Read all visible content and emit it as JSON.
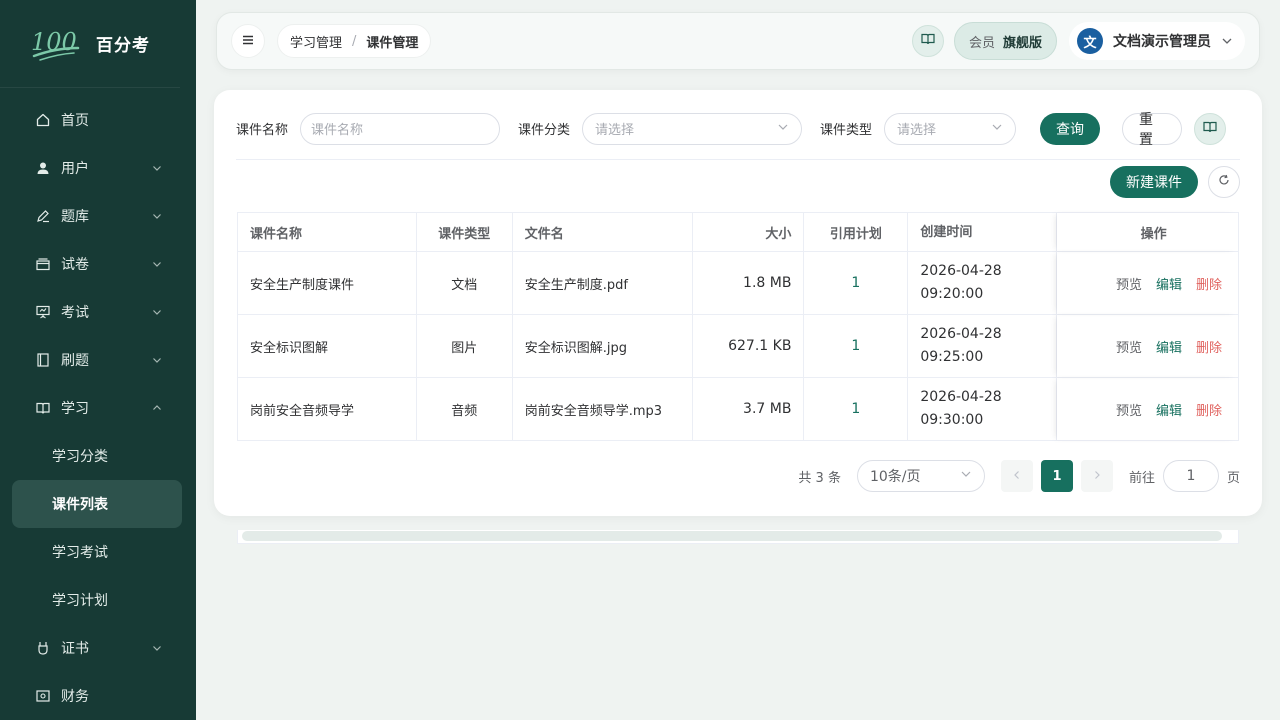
{
  "app": {
    "logo_mark": "100",
    "name": "百分考"
  },
  "sidebar": {
    "items": [
      {
        "label": "首页",
        "icon": "home-icon"
      },
      {
        "label": "用户",
        "icon": "user-icon"
      },
      {
        "label": "题库",
        "icon": "edit-icon"
      },
      {
        "label": "试卷",
        "icon": "paper-icon"
      },
      {
        "label": "考试",
        "icon": "presentation-icon"
      },
      {
        "label": "刷题",
        "icon": "notebook-icon"
      },
      {
        "label": "学习",
        "icon": "book-icon"
      },
      {
        "label": "证书",
        "icon": "medal-icon"
      },
      {
        "label": "财务",
        "icon": "finance-icon"
      }
    ],
    "study_sub": [
      {
        "label": "学习分类"
      },
      {
        "label": "课件列表"
      },
      {
        "label": "学习考试"
      },
      {
        "label": "学习计划"
      }
    ]
  },
  "header": {
    "breadcrumb": [
      "学习管理",
      "课件管理"
    ],
    "breadcrumb_sep": "/",
    "vip_label": "会员",
    "vip_value": "旗舰版",
    "avatar_char": "文",
    "user_name": "文档演示管理员"
  },
  "filters": {
    "name_label": "课件名称",
    "name_placeholder": "课件名称",
    "category_label": "课件分类",
    "category_placeholder": "请选择",
    "type_label": "课件类型",
    "type_placeholder": "请选择",
    "search_button": "查询",
    "reset_button": "重置"
  },
  "toolbar": {
    "new_button": "新建课件"
  },
  "table": {
    "headers": [
      "课件名称",
      "课件类型",
      "文件名",
      "大小",
      "引用计划",
      "创建时间",
      "操作"
    ],
    "rows": [
      {
        "name": "安全生产制度课件",
        "type": "文档",
        "file": "安全生产制度.pdf",
        "size": "1.8 MB",
        "refs": "1",
        "date": "2026-04-28",
        "time": "09:20:00"
      },
      {
        "name": "安全标识图解",
        "type": "图片",
        "file": "安全标识图解.jpg",
        "size": "627.1 KB",
        "refs": "1",
        "date": "2026-04-28",
        "time": "09:25:00"
      },
      {
        "name": "岗前安全音频导学",
        "type": "音频",
        "file": "岗前安全音频导学.mp3",
        "size": "3.7 MB",
        "refs": "1",
        "date": "2026-04-28",
        "time": "09:30:00"
      }
    ],
    "actions": {
      "preview": "预览",
      "edit": "编辑",
      "delete": "删除"
    }
  },
  "pagination": {
    "total": "共 3 条",
    "page_size": "10条/页",
    "current_page": "1",
    "goto_label": "前往",
    "goto_value": "1",
    "page_suffix": "页"
  },
  "colors": {
    "sidebar_bg": "#173a35",
    "primary": "#17705f",
    "danger": "#e0625e"
  }
}
